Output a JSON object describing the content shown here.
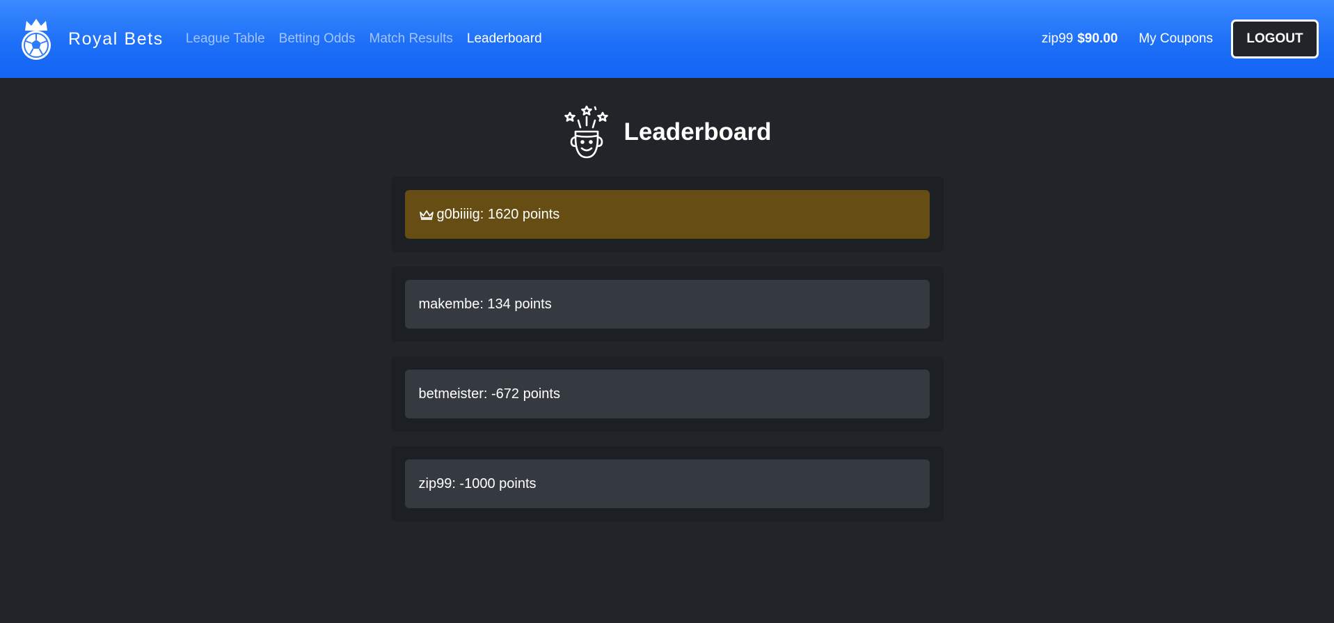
{
  "app": {
    "brand_name": "Royal Bets",
    "icons": {
      "logo": "crowned-soccer-ball-logo",
      "header": "star-struck-head-icon",
      "crown": "crown-icon"
    },
    "colors": {
      "navbar": "#1e6ff7",
      "background": "#212529",
      "entry": "#343a40",
      "top_entry": "#664d13",
      "muted_link": "#a8c8ff"
    }
  },
  "nav": {
    "links": [
      {
        "label": "League Table",
        "active": false
      },
      {
        "label": "Betting Odds",
        "active": false
      },
      {
        "label": "Match Results",
        "active": false
      },
      {
        "label": "Leaderboard",
        "active": true
      }
    ]
  },
  "user": {
    "username": "zip99",
    "balance": "$90.00",
    "coupons_label": "My Coupons",
    "logout_label": "LOGOUT"
  },
  "page": {
    "title": "Leaderboard"
  },
  "leaderboard": [
    {
      "text": "g0biiiig: 1620 points",
      "is_leader": true
    },
    {
      "text": "makembe: 134 points",
      "is_leader": false
    },
    {
      "text": "betmeister: -672 points",
      "is_leader": false
    },
    {
      "text": "zip99: -1000 points",
      "is_leader": false
    }
  ]
}
